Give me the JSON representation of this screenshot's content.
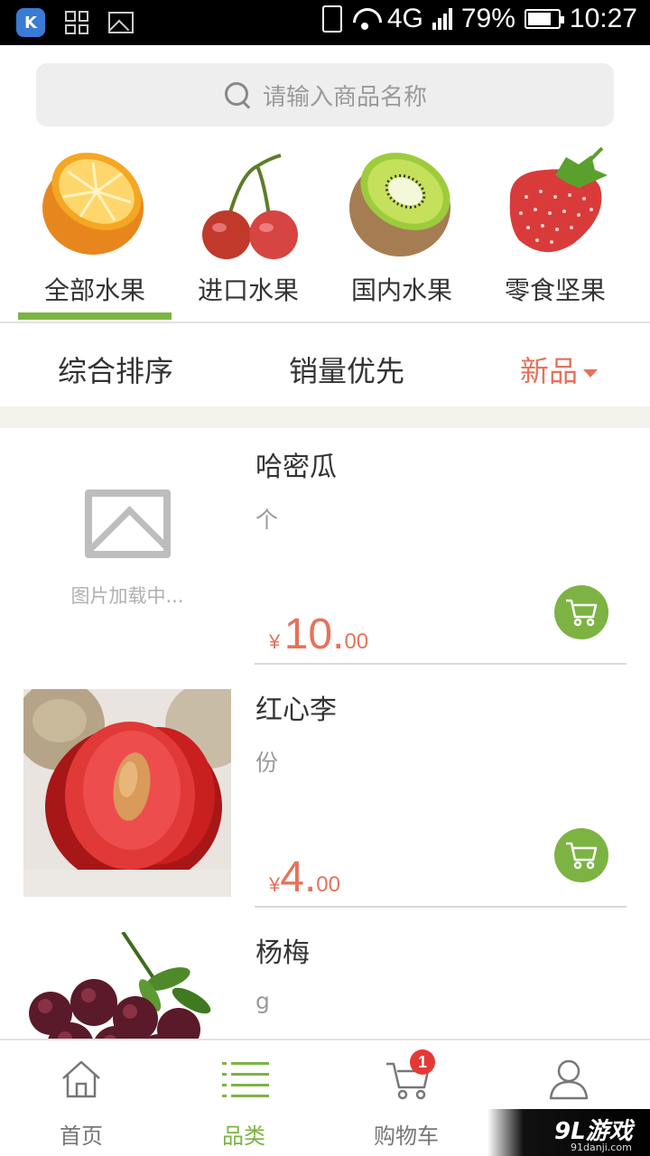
{
  "status_bar": {
    "network": "4G",
    "battery": "79%",
    "battery_level": 0.79,
    "time": "10:27",
    "icons": [
      "app-k-icon",
      "apps-grid-icon",
      "image-icon",
      "vibrate-icon",
      "wifi-icon",
      "signal-icon",
      "battery-icon"
    ]
  },
  "search": {
    "placeholder": "请输入商品名称"
  },
  "categories": [
    {
      "label": "全部水果",
      "icon": "orange-icon",
      "selected": true
    },
    {
      "label": "进口水果",
      "icon": "cherry-icon",
      "selected": false
    },
    {
      "label": "国内水果",
      "icon": "kiwi-icon",
      "selected": false
    },
    {
      "label": "零食坚果",
      "icon": "strawberry-icon",
      "selected": false
    }
  ],
  "sort": {
    "options": [
      {
        "label": "综合排序",
        "active": false
      },
      {
        "label": "销量优先",
        "active": false
      },
      {
        "label": "新品",
        "active": true
      }
    ]
  },
  "products": [
    {
      "name": "哈密瓜",
      "unit": "个",
      "currency": "¥",
      "price_int": "10.",
      "price_dec": "00",
      "image": "placeholder",
      "placeholder_text": "图片加载中..."
    },
    {
      "name": "红心李",
      "unit": "份",
      "currency": "¥",
      "price_int": "4.",
      "price_dec": "00",
      "image": "red-plum-photo"
    },
    {
      "name": "杨梅",
      "unit": "g",
      "image": "bayberry-photo"
    }
  ],
  "tabs": [
    {
      "label": "首页",
      "icon": "home-icon",
      "active": false
    },
    {
      "label": "品类",
      "icon": "list-icon",
      "active": true
    },
    {
      "label": "购物车",
      "icon": "cart-icon",
      "active": false,
      "badge": "1"
    },
    {
      "label": "",
      "icon": "user-icon",
      "active": false
    }
  ],
  "watermark": {
    "main": "9L游戏",
    "sub": "91danji.com"
  },
  "colors": {
    "accent_green": "#7cb342",
    "price_red": "#e5725a",
    "badge_red": "#e53935"
  }
}
